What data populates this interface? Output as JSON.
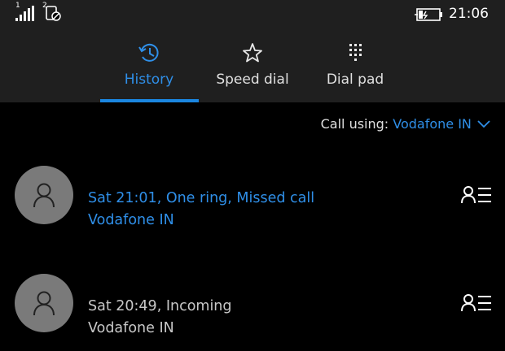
{
  "status_bar": {
    "sim1_label": "1",
    "sim2_label": "2",
    "time": "21:06"
  },
  "tabs": [
    {
      "label": "History",
      "icon": "history-icon",
      "active": true
    },
    {
      "label": "Speed dial",
      "icon": "star-icon",
      "active": false
    },
    {
      "label": "Dial pad",
      "icon": "dialpad-icon",
      "active": false
    }
  ],
  "call_using": {
    "label": "Call using:",
    "carrier": "Vodafone IN"
  },
  "calls": [
    {
      "line1": "Sat 21:01, One ring, Missed call",
      "line2": "Vodafone IN",
      "missed": true
    },
    {
      "line1": "Sat 20:49, Incoming",
      "line2": "Vodafone IN",
      "missed": false
    }
  ],
  "colors": {
    "accent": "#1b86e0",
    "missed_text": "#2f8fe8",
    "header_bg": "#1f1f1f",
    "background": "#000000",
    "avatar_bg": "#7a7a7a"
  }
}
